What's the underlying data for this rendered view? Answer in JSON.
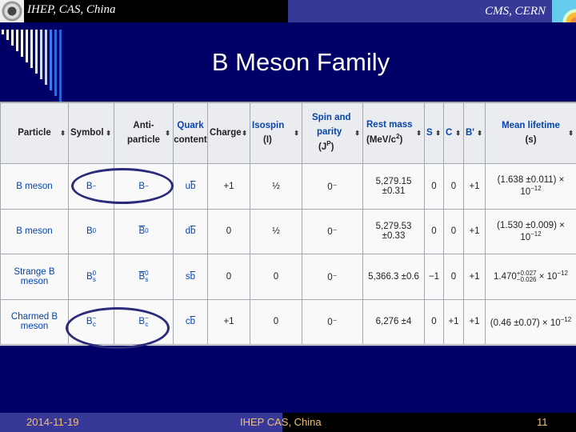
{
  "header": {
    "org_left": "IHEP, CAS, China",
    "org_right": "CMS, CERN",
    "logo_left_icon": "ihep-logo-icon",
    "logo_right_icon": "cms-detector-logo-icon"
  },
  "slide": {
    "title": "B Meson Family"
  },
  "table": {
    "columns": [
      {
        "label": "Particle",
        "sortable": true
      },
      {
        "label": "Symbol",
        "sortable": true
      },
      {
        "label": "Anti-particle",
        "sortable": true
      },
      {
        "label": "Quark content",
        "sortable": false
      },
      {
        "label": "Charge",
        "sortable": true
      },
      {
        "label": "Isospin (I)",
        "sortable": true
      },
      {
        "label": "Spin and parity (J^P)",
        "sortable": true
      },
      {
        "label": "Rest mass (MeV/c^2)",
        "sortable": true
      },
      {
        "label": "S",
        "sortable": true
      },
      {
        "label": "C",
        "sortable": true
      },
      {
        "label": "B'",
        "sortable": true
      },
      {
        "label": "Mean lifetime (s)",
        "sortable": true
      }
    ],
    "header_parts": {
      "particle": "Particle",
      "symbol": "Symbol",
      "anti_1": "Anti-",
      "anti_2": "particle",
      "quark_1": "Quark",
      "quark_2": "content",
      "charge": "Charge",
      "isospin_1": "Isospin",
      "isospin_2": "(I)",
      "spin_1": "Spin and",
      "spin_2": "parity",
      "spin_3a": "(J",
      "spin_3sup": "P",
      "spin_3b": ")",
      "mass_1": "Rest mass",
      "mass_2a": "(MeV/c",
      "mass_2sup": "2",
      "mass_2b": ")",
      "s": "S",
      "c": "C",
      "bprime": "B'",
      "life_1": "Mean lifetime",
      "life_2": "(s)",
      "sort_glyph": "⬍"
    },
    "rows": [
      {
        "particle": "B meson",
        "symbol_base": "B",
        "symbol_sup": "−",
        "symbol_sub": "",
        "anti_base": "B",
        "anti_sup": "−",
        "anti_sub": "",
        "anti_bar": false,
        "quark_a": "u",
        "quark_b": "b",
        "charge": "+1",
        "isospin": "½",
        "spin_parity": "0⁻",
        "mass": "5,279.15 ±0.31",
        "S": "0",
        "C": "0",
        "Bp": "+1",
        "lifetime": "(1.638 ±0.011) × 10",
        "lifetime_exp": "−12",
        "circled": true
      },
      {
        "particle": "B meson",
        "symbol_base": "B",
        "symbol_sup": "0",
        "symbol_sub": "",
        "anti_base": "B",
        "anti_sup": "0",
        "anti_sub": "",
        "anti_bar": true,
        "quark_a": "d",
        "quark_b": "b",
        "charge": "0",
        "isospin": "½",
        "spin_parity": "0⁻",
        "mass": "5,279.53 ±0.33",
        "S": "0",
        "C": "0",
        "Bp": "+1",
        "lifetime": "(1.530 ±0.009) × 10",
        "lifetime_exp": "−12",
        "circled": false
      },
      {
        "particle": "Strange B meson",
        "symbol_base": "B",
        "symbol_sup": "0",
        "symbol_sub": "s",
        "anti_base": "B",
        "anti_sup": "0",
        "anti_sub": "s",
        "anti_bar": true,
        "quark_a": "s",
        "quark_b": "b",
        "charge": "0",
        "isospin": "0",
        "spin_parity": "0⁻",
        "mass": "5,366.3 ±0.6",
        "S": "−1",
        "C": "0",
        "Bp": "+1",
        "lifetime_main": "1.470",
        "lifetime_plus": "+0.027",
        "lifetime_minus": "−0.026",
        "lifetime_tail": "× 10",
        "lifetime_exp": "−12",
        "circled": false
      },
      {
        "particle": "Charmed B meson",
        "symbol_base": "B",
        "symbol_sup": "−",
        "symbol_sub": "c",
        "anti_base": "B",
        "anti_sup": "−",
        "anti_sub": "c",
        "anti_bar": false,
        "quark_a": "c",
        "quark_b": "b",
        "charge": "+1",
        "isospin": "0",
        "spin_parity": "0⁻",
        "mass": "6,276 ±4",
        "S": "0",
        "C": "+1",
        "Bp": "+1",
        "lifetime": "(0.46 ±0.07) × 10",
        "lifetime_exp": "−12",
        "circled": true
      }
    ]
  },
  "footer": {
    "date": "2014-11-19",
    "org": "IHEP CAS, China",
    "page": "11"
  },
  "colors": {
    "background": "#000066",
    "header_band": "#383898",
    "footer_text": "#f0c070",
    "link": "#0645ad",
    "circle": "#2b2b7a"
  }
}
